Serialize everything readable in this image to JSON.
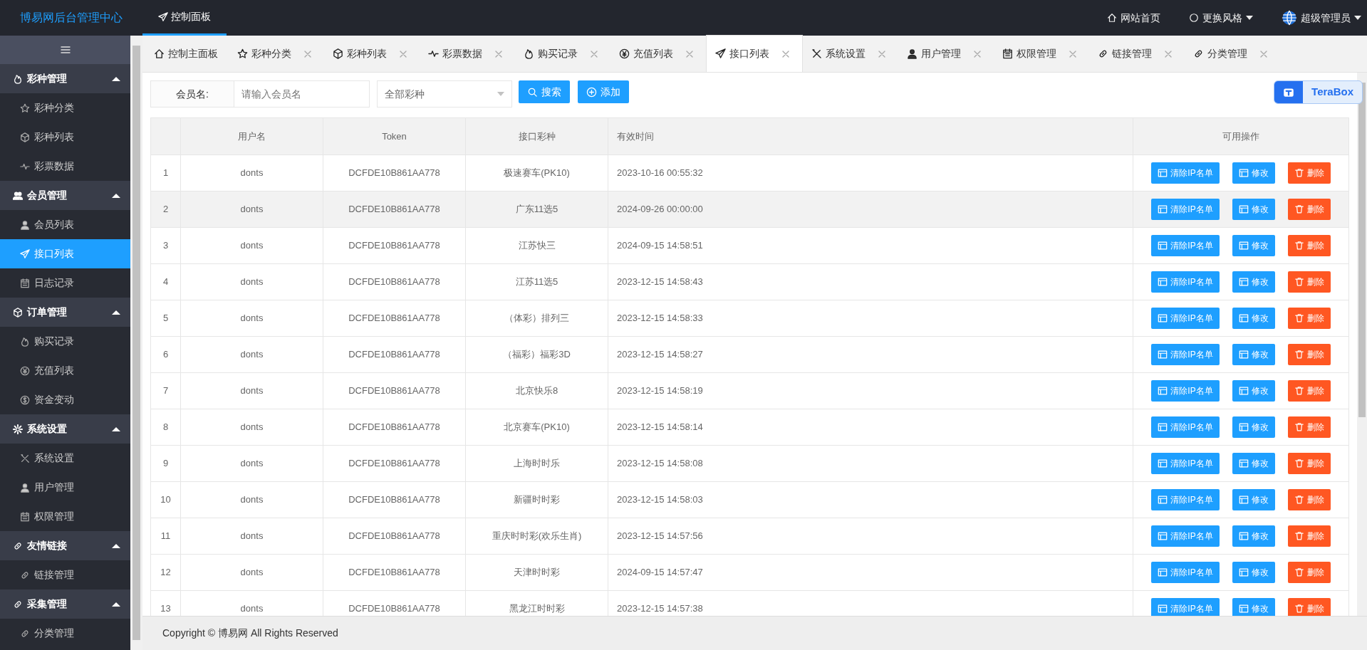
{
  "header": {
    "brand": "博易网后台管理中心",
    "nav": [
      {
        "label": "控制面板",
        "selected": true
      }
    ],
    "links": [
      {
        "label": "网站首页",
        "kind": "home"
      },
      {
        "label": "更换风格",
        "kind": "theme"
      },
      {
        "label": "超级管理员",
        "kind": "user"
      }
    ]
  },
  "sidebar": {
    "groups": [
      {
        "label": "彩种管理",
        "expanded": true,
        "items": [
          {
            "label": "彩种分类",
            "selected": false
          },
          {
            "label": "彩种列表",
            "selected": false
          },
          {
            "label": "彩票数据",
            "selected": false
          }
        ]
      },
      {
        "label": "会员管理",
        "expanded": true,
        "items": [
          {
            "label": "会员列表",
            "selected": false
          },
          {
            "label": "接口列表",
            "selected": true
          },
          {
            "label": "日志记录",
            "selected": false
          }
        ]
      },
      {
        "label": "订单管理",
        "expanded": true,
        "items": [
          {
            "label": "购买记录",
            "selected": false
          },
          {
            "label": "充值列表",
            "selected": false
          },
          {
            "label": "资金变动",
            "selected": false
          }
        ]
      },
      {
        "label": "系统设置",
        "expanded": true,
        "items": [
          {
            "label": "系统设置",
            "selected": false
          },
          {
            "label": "用户管理",
            "selected": false
          },
          {
            "label": "权限管理",
            "selected": false
          }
        ]
      },
      {
        "label": "友情链接",
        "expanded": true,
        "items": [
          {
            "label": "链接管理",
            "selected": false
          }
        ]
      },
      {
        "label": "采集管理",
        "expanded": true,
        "items": [
          {
            "label": "分类管理",
            "selected": false
          }
        ]
      }
    ]
  },
  "tabs": [
    {
      "label": "控制主面板",
      "selected": false,
      "closable": false
    },
    {
      "label": "彩种分类",
      "selected": false,
      "closable": true
    },
    {
      "label": "彩种列表",
      "selected": false,
      "closable": true
    },
    {
      "label": "彩票数据",
      "selected": false,
      "closable": true
    },
    {
      "label": "购买记录",
      "selected": false,
      "closable": true
    },
    {
      "label": "充值列表",
      "selected": false,
      "closable": true
    },
    {
      "label": "接口列表",
      "selected": true,
      "closable": true
    },
    {
      "label": "系统设置",
      "selected": false,
      "closable": true
    },
    {
      "label": "用户管理",
      "selected": false,
      "closable": true
    },
    {
      "label": "权限管理",
      "selected": false,
      "closable": true
    },
    {
      "label": "链接管理",
      "selected": false,
      "closable": true
    },
    {
      "label": "分类管理",
      "selected": false,
      "closable": true
    }
  ],
  "overlay_widget": {
    "label": "TeraBox"
  },
  "filter": {
    "label": "会员名:",
    "placeholder": "请输入会员名",
    "select_value": "全部彩种",
    "buttons": [
      {
        "label": "搜索",
        "kind": "search"
      },
      {
        "label": "添加",
        "kind": "add"
      }
    ]
  },
  "table": {
    "columns": [
      "用户名",
      "Token",
      "接口彩种",
      "有效时间",
      "可用操作"
    ],
    "rows": [
      {
        "index": "1",
        "user": "donts",
        "token": "DCFDE10B861AA778",
        "lottery": "极速赛车(PK10)",
        "valid_until": "2023-10-16 00:55:32",
        "highlighted": false,
        "actions": [
          {
            "label": "清除IP名单",
            "kind": "primary"
          },
          {
            "label": "修改",
            "kind": "primary"
          },
          {
            "label": "删除",
            "kind": "danger"
          }
        ]
      },
      {
        "index": "2",
        "user": "donts",
        "token": "DCFDE10B861AA778",
        "lottery": "广东11选5",
        "valid_until": "2024-09-26 00:00:00",
        "highlighted": true,
        "actions": [
          {
            "label": "清除IP名单",
            "kind": "primary"
          },
          {
            "label": "修改",
            "kind": "primary"
          },
          {
            "label": "删除",
            "kind": "danger"
          }
        ]
      },
      {
        "index": "3",
        "user": "donts",
        "token": "DCFDE10B861AA778",
        "lottery": "江苏快三",
        "valid_until": "2024-09-15 14:58:51",
        "highlighted": false,
        "actions": [
          {
            "label": "清除IP名单",
            "kind": "primary"
          },
          {
            "label": "修改",
            "kind": "primary"
          },
          {
            "label": "删除",
            "kind": "danger"
          }
        ]
      },
      {
        "index": "4",
        "user": "donts",
        "token": "DCFDE10B861AA778",
        "lottery": "江苏11选5",
        "valid_until": "2023-12-15 14:58:43",
        "highlighted": false,
        "actions": [
          {
            "label": "清除IP名单",
            "kind": "primary"
          },
          {
            "label": "修改",
            "kind": "primary"
          },
          {
            "label": "删除",
            "kind": "danger"
          }
        ]
      },
      {
        "index": "5",
        "user": "donts",
        "token": "DCFDE10B861AA778",
        "lottery": "（体彩）排列三",
        "valid_until": "2023-12-15 14:58:33",
        "highlighted": false,
        "actions": [
          {
            "label": "清除IP名单",
            "kind": "primary"
          },
          {
            "label": "修改",
            "kind": "primary"
          },
          {
            "label": "删除",
            "kind": "danger"
          }
        ]
      },
      {
        "index": "6",
        "user": "donts",
        "token": "DCFDE10B861AA778",
        "lottery": "（福彩）福彩3D",
        "valid_until": "2023-12-15 14:58:27",
        "highlighted": false,
        "actions": [
          {
            "label": "清除IP名单",
            "kind": "primary"
          },
          {
            "label": "修改",
            "kind": "primary"
          },
          {
            "label": "删除",
            "kind": "danger"
          }
        ]
      },
      {
        "index": "7",
        "user": "donts",
        "token": "DCFDE10B861AA778",
        "lottery": "北京快乐8",
        "valid_until": "2023-12-15 14:58:19",
        "highlighted": false,
        "actions": [
          {
            "label": "清除IP名单",
            "kind": "primary"
          },
          {
            "label": "修改",
            "kind": "primary"
          },
          {
            "label": "删除",
            "kind": "danger"
          }
        ]
      },
      {
        "index": "8",
        "user": "donts",
        "token": "DCFDE10B861AA778",
        "lottery": "北京赛车(PK10)",
        "valid_until": "2023-12-15 14:58:14",
        "highlighted": false,
        "actions": [
          {
            "label": "清除IP名单",
            "kind": "primary"
          },
          {
            "label": "修改",
            "kind": "primary"
          },
          {
            "label": "删除",
            "kind": "danger"
          }
        ]
      },
      {
        "index": "9",
        "user": "donts",
        "token": "DCFDE10B861AA778",
        "lottery": "上海时时乐",
        "valid_until": "2023-12-15 14:58:08",
        "highlighted": false,
        "actions": [
          {
            "label": "清除IP名单",
            "kind": "primary"
          },
          {
            "label": "修改",
            "kind": "primary"
          },
          {
            "label": "删除",
            "kind": "danger"
          }
        ]
      },
      {
        "index": "10",
        "user": "donts",
        "token": "DCFDE10B861AA778",
        "lottery": "新疆时时彩",
        "valid_until": "2023-12-15 14:58:03",
        "highlighted": false,
        "actions": [
          {
            "label": "清除IP名单",
            "kind": "primary"
          },
          {
            "label": "修改",
            "kind": "primary"
          },
          {
            "label": "删除",
            "kind": "danger"
          }
        ]
      },
      {
        "index": "11",
        "user": "donts",
        "token": "DCFDE10B861AA778",
        "lottery": "重庆时时彩(欢乐生肖)",
        "valid_until": "2023-12-15 14:57:56",
        "highlighted": false,
        "actions": [
          {
            "label": "清除IP名单",
            "kind": "primary"
          },
          {
            "label": "修改",
            "kind": "primary"
          },
          {
            "label": "删除",
            "kind": "danger"
          }
        ]
      },
      {
        "index": "12",
        "user": "donts",
        "token": "DCFDE10B861AA778",
        "lottery": "天津时时彩",
        "valid_until": "2024-09-15 14:57:47",
        "highlighted": false,
        "actions": [
          {
            "label": "清除IP名单",
            "kind": "primary"
          },
          {
            "label": "修改",
            "kind": "primary"
          },
          {
            "label": "删除",
            "kind": "danger"
          }
        ]
      },
      {
        "index": "13",
        "user": "donts",
        "token": "DCFDE10B861AA778",
        "lottery": "黑龙江时时彩",
        "valid_until": "2023-12-15 14:57:38",
        "highlighted": false,
        "actions": [
          {
            "label": "清除IP名单",
            "kind": "primary"
          },
          {
            "label": "修改",
            "kind": "primary"
          },
          {
            "label": "删除",
            "kind": "danger"
          }
        ]
      }
    ]
  },
  "footer": {
    "text": "Copyright © 博易网 All Rights Reserved"
  }
}
